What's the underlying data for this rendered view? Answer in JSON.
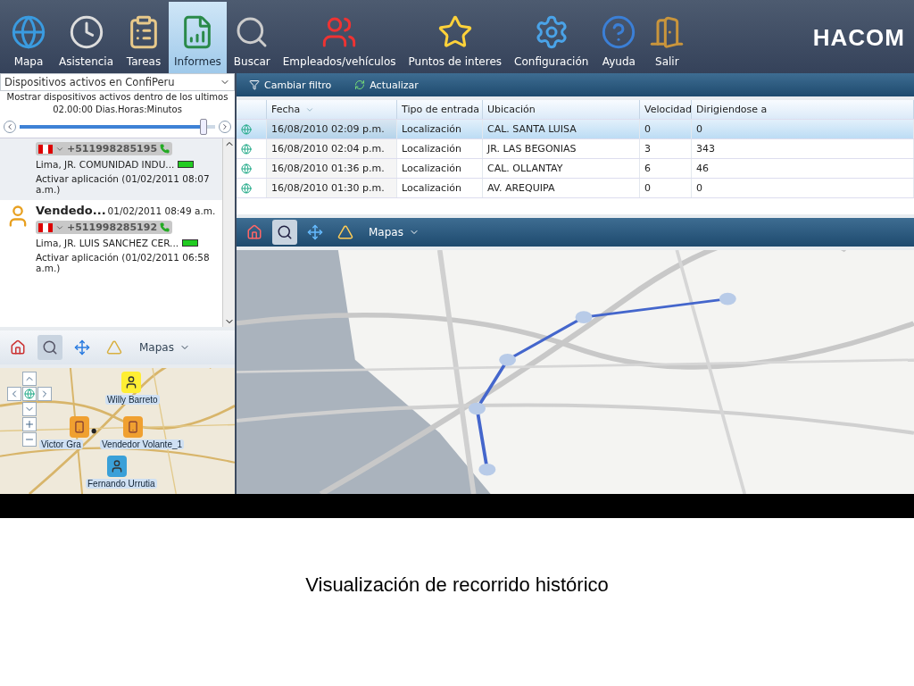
{
  "toolbar": {
    "items": [
      {
        "label": "Mapa",
        "kind": "globe",
        "selected": false
      },
      {
        "label": "Asistencia",
        "kind": "clock",
        "selected": false
      },
      {
        "label": "Tareas",
        "kind": "clipboard",
        "selected": false
      },
      {
        "label": "Informes",
        "kind": "report",
        "selected": true
      },
      {
        "label": "Buscar",
        "kind": "binoculars",
        "selected": false
      },
      {
        "label": "Empleados/vehículos",
        "kind": "people",
        "selected": false
      },
      {
        "label": "Puntos de interes",
        "kind": "star",
        "selected": false
      },
      {
        "label": "Configuración",
        "kind": "config",
        "selected": false
      },
      {
        "label": "Ayuda",
        "kind": "help",
        "selected": false
      },
      {
        "label": "Salir",
        "kind": "door",
        "selected": false
      }
    ],
    "logo": "HACOM"
  },
  "devices_panel": {
    "dropdown": "Dispositivos activos en ConfiPeru",
    "info": "Mostrar dispositivos activos dentro de los ultimos",
    "range": "02.00:00 Dias.Horas:Minutos",
    "slider": {
      "level": 0.96
    },
    "devices": [
      {
        "phone": "+511998285195",
        "address": "Lima, JR. COMUNIDAD INDU...",
        "activity": "Activar aplicación (01/02/2011 08:07 a.m.)",
        "selected": true
      },
      {
        "name": "Vendedo...",
        "time": "01/02/2011 08:49 a.m.",
        "phone": "+511998285192",
        "address": "Lima, JR. LUIS SANCHEZ CER...",
        "activity": "Activar aplicación (01/02/2011 06:58 a.m.)",
        "selected": false
      }
    ]
  },
  "mini_map": {
    "menu": "Mapas",
    "markers": [
      {
        "label": "Willy Barreto",
        "kind": "guard"
      },
      {
        "label": "Victor Gra",
        "kind": "seller"
      },
      {
        "label": "Vendedor Volante_1",
        "kind": "seller"
      },
      {
        "label": "Fernando Urrutia",
        "kind": "person"
      }
    ]
  },
  "history": {
    "actions": [
      "Cambiar filtro",
      "Actualizar"
    ],
    "columns": [
      "Fecha",
      "Tipo de entrada",
      "Ubicación",
      "Velocidad",
      "Dirigiendose a"
    ],
    "rows": [
      {
        "cells": [
          "16/08/2010 02:09 p.m.",
          "Localización",
          "CAL. SANTA LUISA",
          "0",
          "0"
        ],
        "selected": true
      },
      {
        "cells": [
          "16/08/2010 02:04 p.m.",
          "Localización",
          "JR. LAS BEGONIAS",
          "3",
          "343"
        ],
        "selected": false
      },
      {
        "cells": [
          "16/08/2010 01:36 p.m.",
          "Localización",
          "CAL. OLLANTAY",
          "6",
          "46"
        ],
        "selected": false
      },
      {
        "cells": [
          "16/08/2010 01:30 p.m.",
          "Localización",
          "AV. AREQUIPA",
          "0",
          "0"
        ],
        "selected": false
      }
    ]
  },
  "route_map": {
    "menu": "Mapas"
  },
  "caption": "Visualización de recorrido histórico"
}
